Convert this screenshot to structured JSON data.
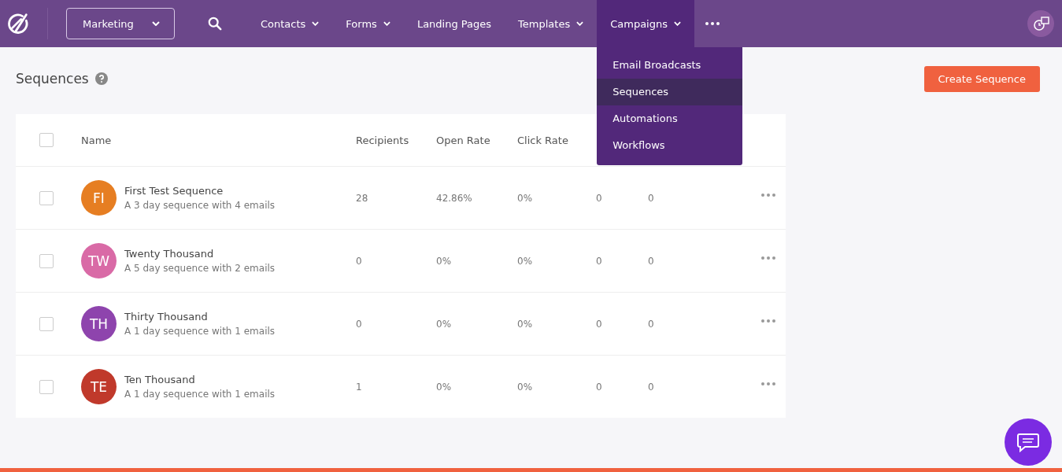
{
  "workspace": {
    "label": "Marketing"
  },
  "nav": [
    {
      "label": "Contacts",
      "dropdown": true,
      "selected": false
    },
    {
      "label": "Forms",
      "dropdown": true,
      "selected": false
    },
    {
      "label": "Landing Pages",
      "dropdown": false,
      "selected": false
    },
    {
      "label": "Templates",
      "dropdown": true,
      "selected": false
    },
    {
      "label": "Campaigns",
      "dropdown": true,
      "selected": true
    }
  ],
  "campaigns_menu": [
    {
      "label": "Email Broadcasts",
      "selected": false
    },
    {
      "label": "Sequences",
      "selected": true
    },
    {
      "label": "Automations",
      "selected": false
    },
    {
      "label": "Workflows",
      "selected": false
    }
  ],
  "page": {
    "title": "Sequences",
    "create_button": "Create Sequence"
  },
  "table": {
    "select_all_checked": false,
    "name_header": "Name",
    "columns": [
      "Recipients",
      "Open Rate",
      "Click Rate"
    ],
    "rows": [
      {
        "initials": "FI",
        "color": "#e67e22",
        "name": "First Test Sequence",
        "description": "A 3 day sequence with 4 emails",
        "checked": false,
        "cells": [
          "28",
          "42.86%",
          "0%",
          "0",
          "0"
        ]
      },
      {
        "initials": "TW",
        "color": "#d96aa6",
        "name": "Twenty Thousand",
        "description": "A 5 day sequence with 2 emails",
        "checked": false,
        "cells": [
          "0",
          "0%",
          "0%",
          "0",
          "0"
        ]
      },
      {
        "initials": "TH",
        "color": "#8e44ad",
        "name": "Thirty Thousand",
        "description": "A 1 day sequence with 1 emails",
        "checked": false,
        "cells": [
          "0",
          "0%",
          "0%",
          "0",
          "0"
        ]
      },
      {
        "initials": "TE",
        "color": "#c0392b",
        "name": "Ten Thousand",
        "description": "A 1 day sequence with 1 emails",
        "checked": false,
        "cells": [
          "1",
          "0%",
          "0%",
          "0",
          "0"
        ]
      }
    ]
  }
}
